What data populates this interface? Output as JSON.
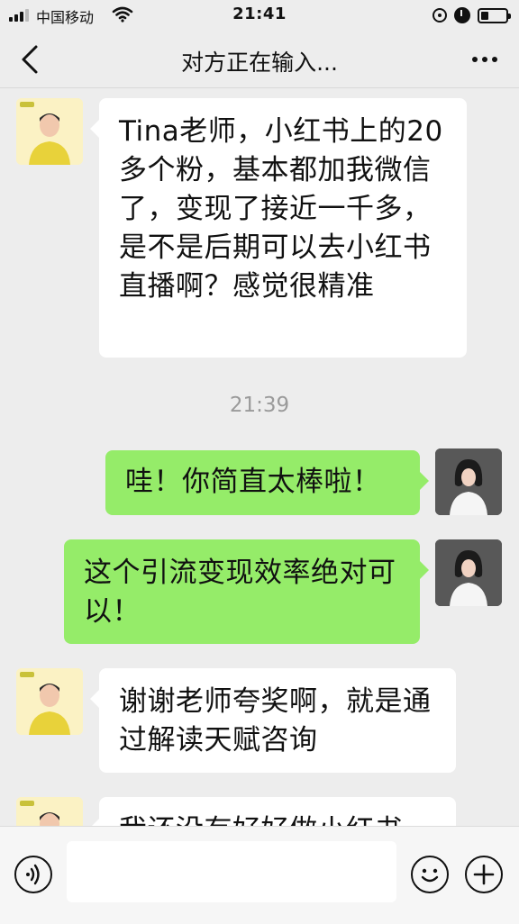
{
  "status_bar": {
    "carrier": "中国移动",
    "time": "21:41"
  },
  "nav": {
    "title": "对方正在输入..."
  },
  "chat": {
    "time_separator": "21:39",
    "messages": [
      {
        "side": "left",
        "text": "Tina老师，小红书上的20多个粉，基本都加我微信了，变现了接近一千多，是不是后期可以去小红书直播啊？感觉很精准"
      },
      {
        "side": "right",
        "text": "哇！你简直太棒啦！"
      },
      {
        "side": "right",
        "text": "这个引流变现效率绝对可以！"
      },
      {
        "side": "left",
        "text": "谢谢老师夸奖啊，就是通过解读天赋咨询"
      },
      {
        "side": "left",
        "text": "我还没有好好做小红书"
      }
    ]
  },
  "icons": {
    "back": "chevron-left-icon",
    "more": "more-dots-icon",
    "voice": "voice-icon",
    "emoji": "emoji-icon",
    "plus": "plus-icon"
  },
  "colors": {
    "background": "#ededed",
    "bubble_self": "#95ec69",
    "bubble_other": "#ffffff"
  }
}
